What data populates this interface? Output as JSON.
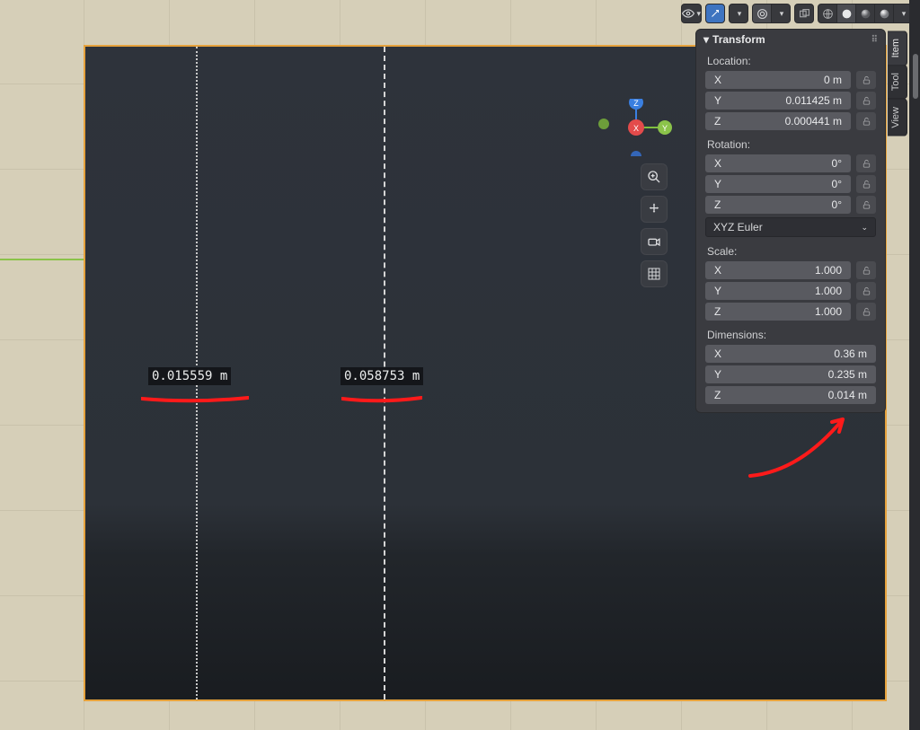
{
  "viewport": {
    "measure1": "0.015559 m",
    "measure2": "0.058753 m"
  },
  "gizmo": {
    "x": "X",
    "y": "Y",
    "z": "Z"
  },
  "npanel": {
    "title": "Transform",
    "location": {
      "label": "Location:",
      "x_label": "X",
      "x_val": "0 m",
      "y_label": "Y",
      "y_val": "0.011425 m",
      "z_label": "Z",
      "z_val": "0.000441 m"
    },
    "rotation": {
      "label": "Rotation:",
      "x_label": "X",
      "x_val": "0°",
      "y_label": "Y",
      "y_val": "0°",
      "z_label": "Z",
      "z_val": "0°",
      "mode": "XYZ Euler"
    },
    "scale": {
      "label": "Scale:",
      "x_label": "X",
      "x_val": "1.000",
      "y_label": "Y",
      "y_val": "1.000",
      "z_label": "Z",
      "z_val": "1.000"
    },
    "dimensions": {
      "label": "Dimensions:",
      "x_label": "X",
      "x_val": "0.36 m",
      "y_label": "Y",
      "y_val": "0.235 m",
      "z_label": "Z",
      "z_val": "0.014 m"
    }
  },
  "tabs": {
    "item": "Item",
    "tool": "Tool",
    "view": "View"
  }
}
